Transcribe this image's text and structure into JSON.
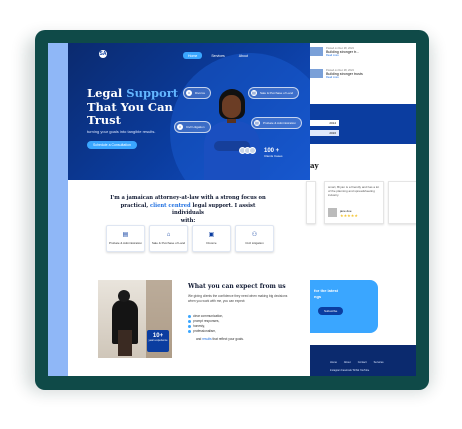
{
  "nav": {
    "logo": "SA",
    "items": [
      "Home",
      "Services",
      "About"
    ]
  },
  "hero": {
    "title_line1_a": "Legal ",
    "title_line1_b": "Support",
    "title_line2": "That You Can",
    "title_line3": "Trust",
    "subtitle": "turning your goals into tangible results.",
    "cta": "Schedule a Consultation",
    "pills": [
      "Divorce",
      "Sale & Purchase of Land",
      "Civil Litigation",
      "Probate & Administration"
    ],
    "clients_count": "100 +",
    "clients_label": "Clients Cases"
  },
  "about": {
    "line_a": "I'm a jamaican attorney-at-law with a strong focus on",
    "line_b_a": "practical, ",
    "line_b_hl": "client centred",
    "line_b_b": " legal support. I assist individuals",
    "line_c": "with:"
  },
  "services": [
    {
      "label": "Probate & Administration",
      "icon": "document-icon"
    },
    {
      "label": "Sale & Purchase of Land",
      "icon": "house-icon"
    },
    {
      "label": "Divorce",
      "icon": "briefcase-icon"
    },
    {
      "label": "Civil Litigation",
      "icon": "people-icon"
    }
  ],
  "experience": {
    "number": "10+",
    "label": "years experience"
  },
  "expect": {
    "title": "What you can expect from us",
    "intro": "We giving clients the confidence they need when making big decisions when you work with me, you can expect:",
    "items": [
      "clear communication,",
      "prompt responses,",
      "honesty,",
      "professionalism,"
    ],
    "end_a": "and ",
    "end_hl": "results",
    "end_b": " that reflect your goals."
  },
  "peek": {
    "posts": [
      {
        "meta": "Posted on Dec 28, 2024",
        "title": "Building stronger tr...",
        "more": "Read more"
      },
      {
        "meta": "Posted on Dec 28, 2024",
        "title": "Building stronger trusts",
        "more": "Read more"
      }
    ],
    "table_values": [
      "2014",
      "2016"
    ],
    "heading": "ay",
    "testimonial": {
      "quote": "smart, Bryan is a friendly and has a lot of the planning and spreadsheeting industry.",
      "name": "jane doe",
      "stars": "★★★★★"
    },
    "newsletter_text": "for the latest",
    "newsletter_text2": "ngs",
    "newsletter_button": "Subscribe",
    "footer_links": [
      "Home",
      "About",
      "Contact",
      "Services"
    ],
    "footer_social": "Instagram  Facebook  TikTok  YouTube"
  },
  "colors": {
    "frame": "#0f4a48",
    "hero": "#0b3da0",
    "accent": "#3aa6ff",
    "screen_bg": "#8fb7f7"
  }
}
